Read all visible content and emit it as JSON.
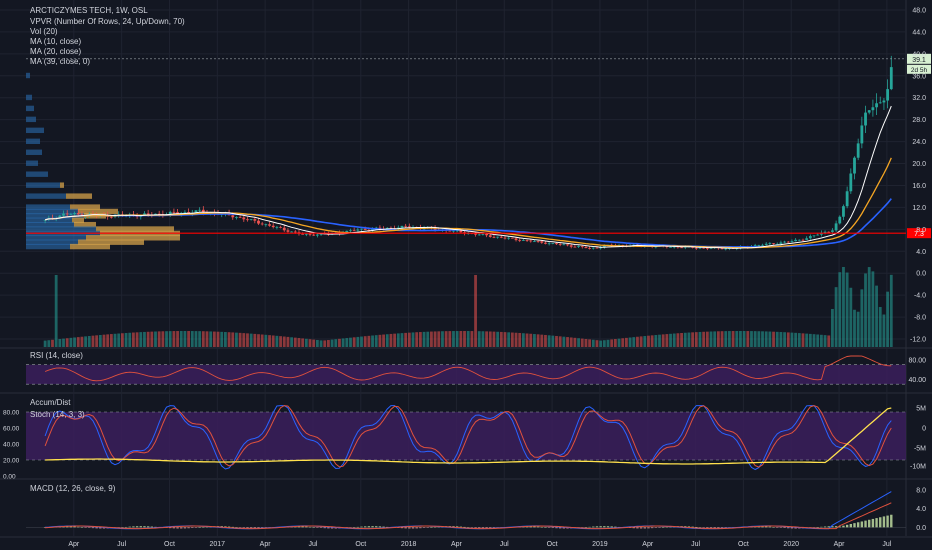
{
  "chart_data": {
    "type": "candlestick",
    "title": "ARCTICZYMES TECH, 1W, OSL",
    "legend": [
      "VPVR (Number Of Rows, 24, Up/Down, 70)",
      "Vol (20)",
      "MA (10, close)",
      "MA (20, close)",
      "MA (39, close, 0)"
    ],
    "price_axis": [
      "48.0",
      "44.0",
      "40.0",
      "36.0",
      "32.0",
      "28.0",
      "24.0",
      "20.0",
      "16.0",
      "12.0",
      "8.0",
      "4.0",
      "0.0",
      "-4.0",
      "-8.0",
      "-12.0"
    ],
    "last_price_label": "39.1",
    "countdown_label": "2d 5h",
    "ref_price_label": "7.3",
    "x_axis": [
      "Apr",
      "Jul",
      "Oct",
      "2017",
      "Apr",
      "Jul",
      "Oct",
      "2018",
      "Apr",
      "Jul",
      "Oct",
      "2019",
      "Apr",
      "Jul",
      "Oct",
      "2020",
      "Apr",
      "Jul"
    ],
    "close_series": [
      [
        2016.1,
        9.6
      ],
      [
        2016.2,
        10.8
      ],
      [
        2016.4,
        10.5
      ],
      [
        2016.6,
        10.6
      ],
      [
        2016.8,
        11.0
      ],
      [
        2016.9,
        11.3
      ],
      [
        2017.0,
        10.9
      ],
      [
        2017.1,
        10.3
      ],
      [
        2017.2,
        9.4
      ],
      [
        2017.3,
        8.4
      ],
      [
        2017.45,
        7.0
      ],
      [
        2017.6,
        7.2
      ],
      [
        2017.75,
        8.0
      ],
      [
        2017.9,
        8.2
      ],
      [
        2018.0,
        8.5
      ],
      [
        2018.1,
        8.2
      ],
      [
        2018.25,
        7.6
      ],
      [
        2018.4,
        6.9
      ],
      [
        2018.55,
        6.2
      ],
      [
        2018.7,
        5.6
      ],
      [
        2018.85,
        5.0
      ],
      [
        2018.95,
        4.5
      ],
      [
        2019.05,
        5.1
      ],
      [
        2019.2,
        5.0
      ],
      [
        2019.4,
        4.8
      ],
      [
        2019.55,
        4.6
      ],
      [
        2019.7,
        4.5
      ],
      [
        2019.8,
        5.0
      ],
      [
        2019.9,
        5.4
      ],
      [
        2020.0,
        5.8
      ],
      [
        2020.08,
        6.4
      ],
      [
        2020.15,
        7.2
      ],
      [
        2020.22,
        8.0
      ],
      [
        2020.26,
        10.5
      ],
      [
        2020.3,
        16.0
      ],
      [
        2020.34,
        23.0
      ],
      [
        2020.38,
        28.0
      ],
      [
        2020.42,
        30.5
      ],
      [
        2020.46,
        31.0
      ],
      [
        2020.5,
        33.0
      ],
      [
        2020.54,
        39.1
      ]
    ],
    "volume_axis_note": "",
    "rsi": {
      "label": "RSI (14, close)",
      "axis": [
        "80.00",
        "40.00"
      ],
      "bands": [
        70,
        30
      ]
    },
    "accum_dist": {
      "label": "Accum/Dist",
      "axis": [
        "5M",
        "0",
        "-5M",
        "-10M"
      ]
    },
    "stoch": {
      "label": "Stoch (14, 3, 3)",
      "axis": [
        "80.00",
        "60.00",
        "40.00",
        "20.00",
        "0.00"
      ],
      "bands": [
        80,
        20
      ]
    },
    "macd": {
      "label": "MACD (12, 26, close, 9)",
      "axis": [
        "8.0",
        "4.0",
        "0.0"
      ]
    },
    "colors": {
      "up": "#26a69a",
      "down": "#ef5350",
      "ma10": "#ffffff",
      "ma20": "#f5a623",
      "ma39": "#2962ff",
      "ref_line": "#ff0000",
      "vpvr_up": "#2a6aad",
      "vpvr_down": "#d4a24a",
      "osc_bg": "#3b1f5c",
      "rsi_line": "#e0513d",
      "ad_line": "#ffe14d",
      "stoch_k": "#2962ff",
      "stoch_d": "#e0513d"
    }
  }
}
